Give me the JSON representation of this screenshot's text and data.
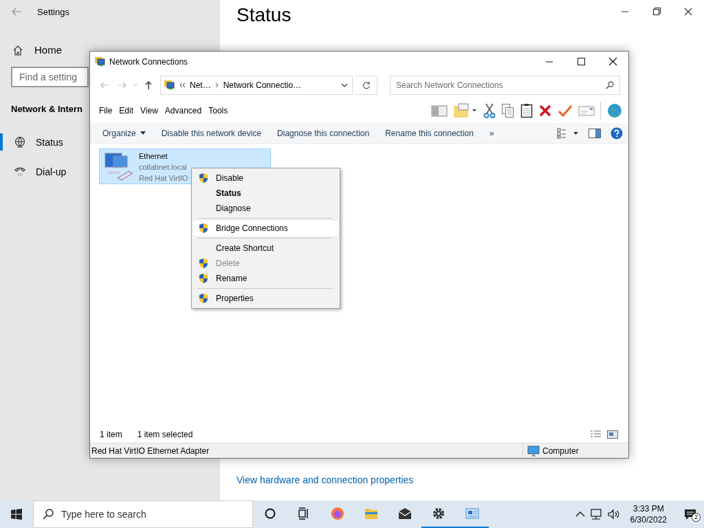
{
  "settings": {
    "title": "Settings",
    "home": "Home",
    "search": {
      "placeholder": "Find a setting"
    },
    "section": "Network & Intern",
    "items": [
      {
        "label": "Status",
        "selected": true
      },
      {
        "label": "Dial-up",
        "selected": false
      }
    ],
    "heading": "Status",
    "link": "View hardware and connection properties"
  },
  "explorer": {
    "title": "Network Connections",
    "breadcrumb": [
      "Net…",
      "Network Connectio…"
    ],
    "search": {
      "placeholder": "Search Network Connections"
    },
    "menu": [
      "File",
      "Edit",
      "View",
      "Advanced",
      "Tools"
    ],
    "toolbar": [
      {
        "kind": "pane"
      },
      {
        "kind": "folder"
      },
      {
        "kind": "cut"
      },
      {
        "kind": "copy"
      },
      {
        "kind": "paste"
      },
      {
        "kind": "delete"
      },
      {
        "kind": "check"
      },
      {
        "kind": "card"
      },
      {
        "kind": "globe"
      }
    ],
    "commands": [
      {
        "label": "Organize",
        "dropdown": true
      },
      {
        "label": "Disable this network device",
        "dropdown": false
      },
      {
        "label": "Diagnose this connection",
        "dropdown": false
      },
      {
        "label": "Rename this connection",
        "dropdown": false
      },
      {
        "label": "»",
        "dropdown": false
      }
    ],
    "items": [
      {
        "name": "Ethernet",
        "network": "collabnet.local",
        "device": "Red Hat VirtIO",
        "selected": true
      }
    ],
    "status": {
      "count": "1 item",
      "selection": "1 item selected"
    },
    "details": {
      "text": "Red Hat VirtIO Ethernet Adapter",
      "zone": "Computer"
    }
  },
  "context_menu": {
    "groups": [
      [
        {
          "label": "Disable",
          "shield": true,
          "bold": false,
          "disabled": false,
          "selected": false
        },
        {
          "label": "Status",
          "shield": false,
          "bold": true,
          "disabled": false,
          "selected": false
        },
        {
          "label": "Diagnose",
          "shield": false,
          "bold": false,
          "disabled": false,
          "selected": false
        }
      ],
      [
        {
          "label": "Bridge Connections",
          "shield": true,
          "bold": false,
          "disabled": false,
          "selected": true
        }
      ],
      [
        {
          "label": "Create Shortcut",
          "shield": false,
          "bold": false,
          "disabled": false,
          "selected": false
        },
        {
          "label": "Delete",
          "shield": true,
          "bold": false,
          "disabled": true,
          "selected": false
        },
        {
          "label": "Rename",
          "shield": true,
          "bold": false,
          "disabled": false,
          "selected": false
        }
      ],
      [
        {
          "label": "Properties",
          "shield": true,
          "bold": false,
          "disabled": false,
          "selected": false
        }
      ]
    ]
  },
  "taskbar": {
    "search": {
      "placeholder": "Type here to search"
    },
    "apps": [
      {
        "kind": "cortana",
        "open": false
      },
      {
        "kind": "taskview",
        "open": false
      },
      {
        "kind": "firefox",
        "open": false
      },
      {
        "kind": "folder",
        "open": false
      },
      {
        "kind": "mail",
        "open": false
      },
      {
        "kind": "settings",
        "open": true
      },
      {
        "kind": "network",
        "open": true
      }
    ],
    "time": "3:33 PM",
    "date": "6/30/2022",
    "notifications": "2"
  }
}
